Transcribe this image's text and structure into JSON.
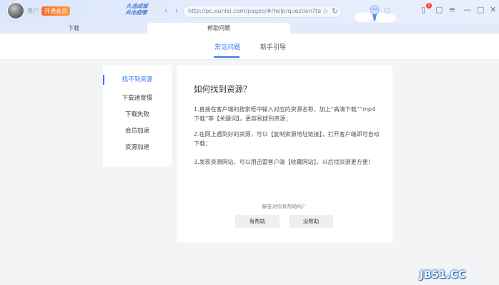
{
  "topbar": {
    "username": "用户",
    "vip_label": "开通会员",
    "slogan_line1": "久违成城",
    "slogan_line2": "共击疫情",
    "url": "http://pc.xunlei.com/pages/#/help/question?target=",
    "badge_count": "1"
  },
  "tabs": {
    "download": "下载",
    "help": "帮助问题"
  },
  "subtabs": {
    "faq": "常见问题",
    "guide": "新手引导"
  },
  "sidemenu": {
    "items": [
      {
        "label": "找不到资源"
      },
      {
        "label": "下载速度慢"
      },
      {
        "label": "下载失败"
      },
      {
        "label": "会员加速"
      },
      {
        "label": "资源加速"
      }
    ]
  },
  "content": {
    "title": "如何找到资源？",
    "para1": "1.直接在客户端的搜索框中输入对应的资源名称，加上“高清下载”“mp4下载”等【关键词】，更容易搜到资源；",
    "para2": "2.在网上遇到好的资源，可以【复制资源地址链接】，打开客户端即可自动下载；",
    "para3": "3.发现资源网站，可以用迅雷客户端【收藏网站】，以后找资源更方便！",
    "helpful_question": "解答对你有帮助吗？",
    "helpful_yes": "有帮助",
    "helpful_no": "没帮助"
  },
  "watermark": "JB51.CC",
  "colors": {
    "accent": "#3779f0",
    "vip": "#f46b2b",
    "background": "#f3f4f6"
  }
}
